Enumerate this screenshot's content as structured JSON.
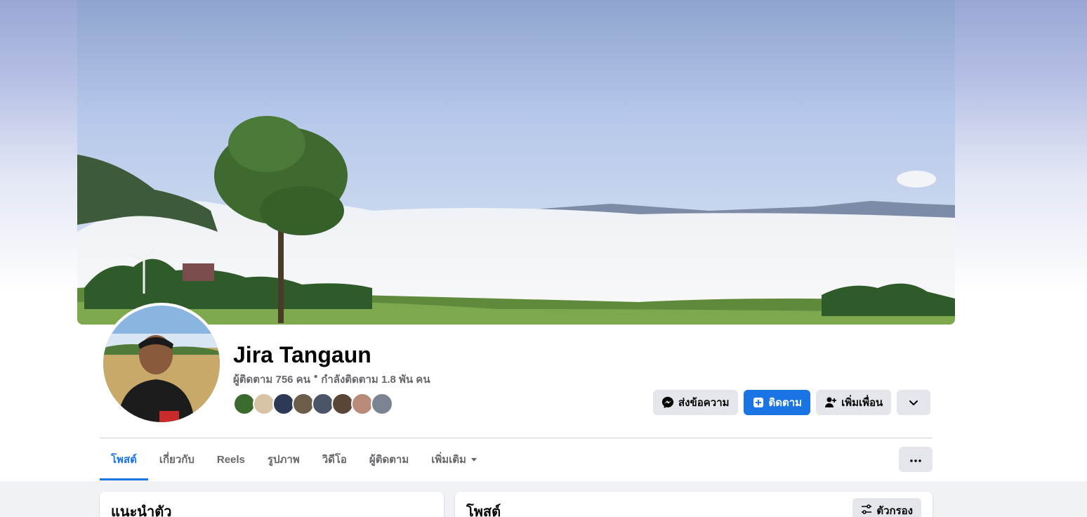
{
  "profile": {
    "name": "Jira Tangaun",
    "followers": "ผู้ติดตาม 756 คน",
    "separator": "•",
    "following": "กำลังติดตาม 1.8 พัน คน"
  },
  "actions": {
    "message_label": "ส่งข้อความ",
    "follow_label": "ติดตาม",
    "add_friend_label": "เพิ่มเพื่อน",
    "expand_icon": "chevron-down-icon"
  },
  "tabs": [
    {
      "label": "โพสต์",
      "active": true
    },
    {
      "label": "เกี่ยวกับ",
      "active": false
    },
    {
      "label": "Reels",
      "active": false
    },
    {
      "label": "รูปภาพ",
      "active": false
    },
    {
      "label": "วิดีโอ",
      "active": false
    },
    {
      "label": "ผู้ติดตาม",
      "active": false
    },
    {
      "label": "เพิ่มเติม",
      "active": false,
      "dropdown": true
    }
  ],
  "intro_card": {
    "title": "แนะนำตัว"
  },
  "posts_card": {
    "title": "โพสต์",
    "filter_label": "ตัวกรอง"
  },
  "colors": {
    "accent": "#1b74e4",
    "button_gray": "#e4e6eb",
    "secondary_text": "#65676b"
  }
}
